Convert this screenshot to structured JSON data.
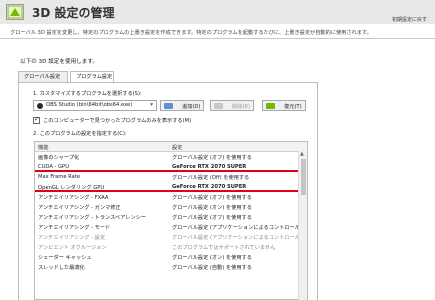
{
  "header": {
    "title": "3D 設定の管理",
    "restore_label": "初期設定に戻す"
  },
  "description": "グローバル 3D 設定を変更し、特定のプログラムの上書き設定を作成できます。特定のプログラムを起動するたびに、上書き設定が自動的に使用されます。",
  "section_label": "以下の 3D 設定を使用します。",
  "tabs": [
    {
      "label": "グローバル設定",
      "active": false
    },
    {
      "label": "プログラム設定",
      "active": true
    }
  ],
  "step1_label": "1. カスタマイズするプログラムを選択する(S):",
  "program_select": {
    "value": "OBS Studio (bin\\64bit\\obs64.exe)"
  },
  "buttons": {
    "add": "追加(D)",
    "delete": "削除(R)",
    "restore": "復元(T)"
  },
  "checkbox": {
    "label": "このコンピューターで見つかったプログラムのみを表示する(M)",
    "checked": true
  },
  "step2_label": "2. このプログラムの設定を指定する(C):",
  "table": {
    "headers": [
      "機能",
      "設定"
    ],
    "rows": [
      {
        "feature": "画像のシャープ化",
        "setting": "グローバル設定 (オフ) を使用する",
        "highlight": false,
        "emphasis": false,
        "gray": false
      },
      {
        "feature": "CUDA - GPU",
        "setting": "GeForce RTX 2070 SUPER",
        "highlight": true,
        "emphasis": true,
        "gray": false
      },
      {
        "feature": "Max Frame Rate",
        "setting": "グローバル設定 (Off) を使用する",
        "highlight": false,
        "emphasis": false,
        "gray": false
      },
      {
        "feature": "OpenGL レンダリング GPU",
        "setting": "GeForce RTX 2070 SUPER",
        "highlight": true,
        "emphasis": true,
        "gray": false
      },
      {
        "feature": "アンチエイリアシング - FXAA",
        "setting": "グローバル設定 (オフ) を使用する",
        "highlight": false,
        "emphasis": false,
        "gray": false
      },
      {
        "feature": "アンチエイリアシング - ガンマ修正",
        "setting": "グローバル設定 (オン) を使用する",
        "highlight": false,
        "emphasis": false,
        "gray": false
      },
      {
        "feature": "アンチエイリアシング - トランスペアレンシー",
        "setting": "グローバル設定 (オフ) を使用する",
        "highlight": false,
        "emphasis": false,
        "gray": false
      },
      {
        "feature": "アンチエイリアシング - モード",
        "setting": "グローバル設定 (アプリケーションによるコントロール) を使...",
        "highlight": false,
        "emphasis": false,
        "gray": false
      },
      {
        "feature": "アンチエイリアシング - 設定",
        "setting": "グローバル設定 (アプリケーションによるコントロール) を使...",
        "highlight": false,
        "emphasis": false,
        "gray": true
      },
      {
        "feature": "アンビエント オクルージョン",
        "setting": "このプログラムではサポートされていません",
        "highlight": false,
        "emphasis": false,
        "gray": true
      },
      {
        "feature": "シェーダー キャッシュ",
        "setting": "グローバル設定 (オン) を使用する",
        "highlight": false,
        "emphasis": false,
        "gray": false
      },
      {
        "feature": "スレッドした最適化",
        "setting": "グローバル設定 (自動) を使用する",
        "highlight": false,
        "emphasis": false,
        "gray": false
      }
    ]
  },
  "colors": {
    "highlight": "#e00018",
    "nvidia_green": "#76b900"
  }
}
